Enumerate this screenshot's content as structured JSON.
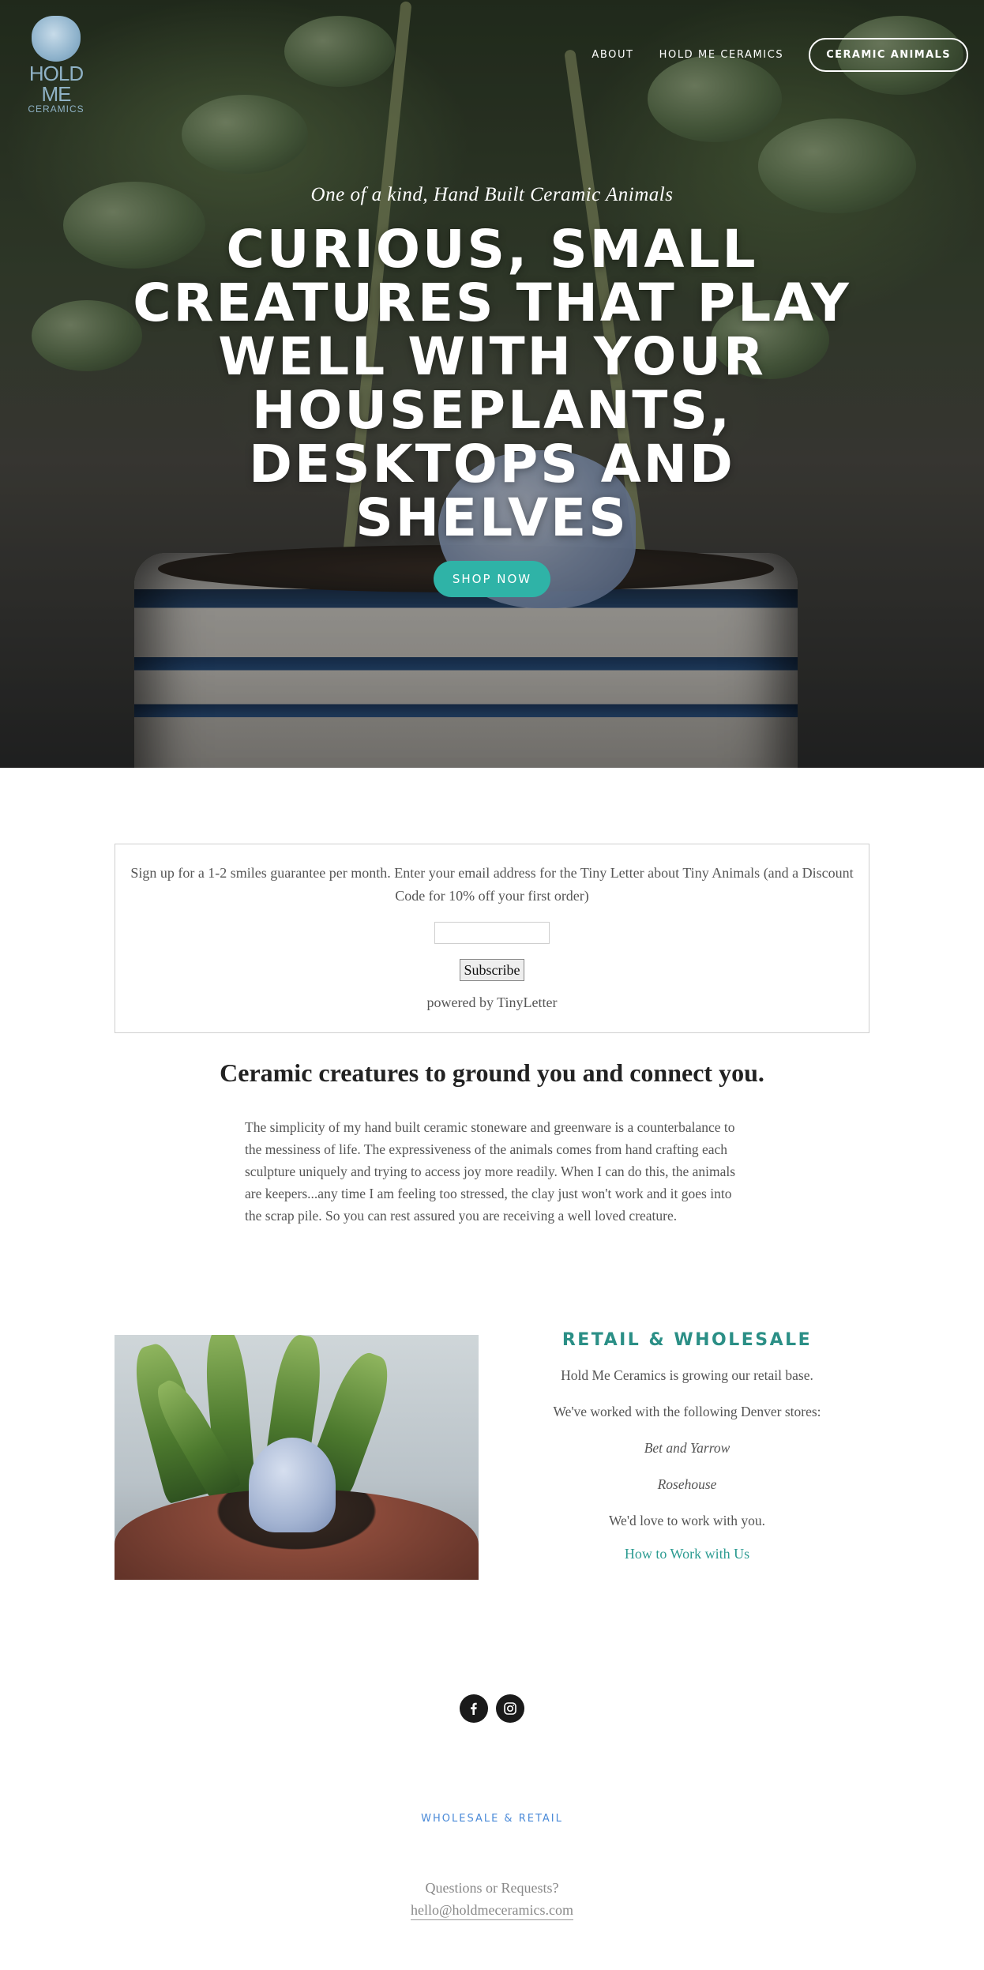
{
  "brand": {
    "logo_name": "HOLD ME",
    "logo_sub": "CERAMICS"
  },
  "nav": {
    "about": "ABOUT",
    "hold_me_ceramics": "HOLD ME CERAMICS",
    "ceramic_animals": "CERAMIC ANIMALS"
  },
  "hero": {
    "tagline": "One of a kind, Hand Built Ceramic Animals",
    "title": "CURIOUS, SMALL CREATURES THAT PLAY WELL WITH YOUR HOUSEPLANTS, DESKTOPS AND SHELVES",
    "cta": "SHOP NOW"
  },
  "signup": {
    "text": "Sign up for a 1-2 smiles guarantee per month. Enter your email address for the Tiny Letter about Tiny Animals (and a Discount Code for 10% off your first order)",
    "input_value": "",
    "button": "Subscribe",
    "powered": "powered by TinyLetter"
  },
  "intro": {
    "heading": "Ceramic creatures to ground you and connect you.",
    "body": "The simplicity of my hand built ceramic stoneware and greenware is a counterbalance to the messiness of life. The expressiveness of the animals comes from hand crafting each sculpture uniquely and trying to access joy more readily. When I can do this, the animals are keepers...any time I am feeling too stressed, the clay just won't work and it goes into the scrap pile. So you can rest assured you are receiving a well loved creature."
  },
  "retail": {
    "title": "RETAIL & WHOLESALE",
    "line1": "Hold Me Ceramics is growing our retail base.",
    "line2": "We've worked with the following Denver stores:",
    "store1": "Bet and Yarrow",
    "store2": "Rosehouse",
    "line3": "We'd love to work with you.",
    "link": "How to Work with Us"
  },
  "social": {
    "facebook_icon": "facebook-icon",
    "instagram_icon": "instagram-icon"
  },
  "footer": {
    "link": "WHOLESALE & RETAIL",
    "question": "Questions or Requests?",
    "email": "hello@holdmeceramics.com"
  },
  "colors": {
    "accent": "#2fb3a7",
    "teal_text": "#2b8f86",
    "footer_link": "#4a8ad8"
  }
}
